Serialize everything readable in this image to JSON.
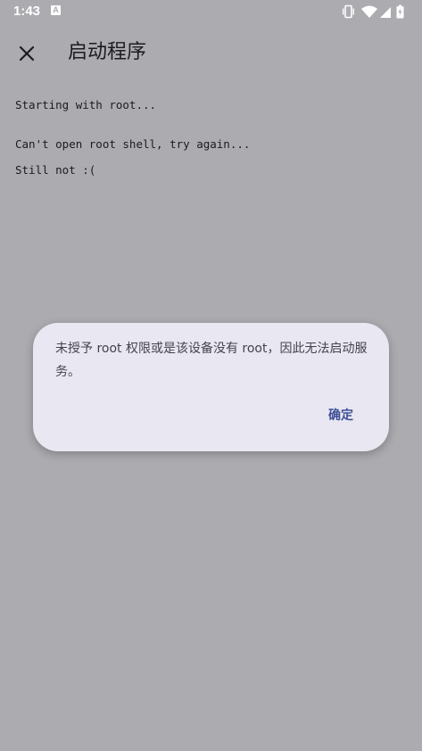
{
  "status_bar": {
    "time": "1:43",
    "notification_letter": "A"
  },
  "app_bar": {
    "title": "启动程序"
  },
  "log": {
    "lines": [
      "Starting with root...",
      "Can't open root shell, try again...",
      "Still not :("
    ]
  },
  "dialog": {
    "message": "未授予 root 权限或是该设备没有 root，因此无法启动服务。",
    "confirm_label": "确定"
  },
  "colors": {
    "scrim_background": "#acabaf",
    "dialog_background": "#e8e7f2",
    "accent": "#3f4f95",
    "text": "#1c1b1f"
  },
  "icons": {
    "close": "close-icon",
    "vibrate": "vibrate-icon",
    "wifi": "wifi-icon",
    "signal": "signal-icon",
    "battery": "battery-icon"
  }
}
